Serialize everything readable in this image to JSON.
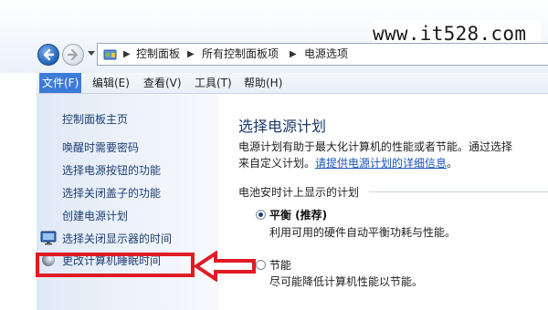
{
  "watermark": "www.it528.com",
  "address_bar": {
    "icon": "control-panel-icon",
    "breadcrumbs": [
      "控制面板",
      "所有控制面板项",
      "电源选项"
    ]
  },
  "menu": {
    "items": [
      "文件(F)",
      "编辑(E)",
      "查看(V)",
      "工具(T)",
      "帮助(H)"
    ],
    "active_item": "文件(F)"
  },
  "left_pane": {
    "title": "控制面板主页",
    "links": [
      {
        "label": "唤醒时需要密码",
        "icon": ""
      },
      {
        "label": "选择电源按钮的功能",
        "icon": ""
      },
      {
        "label": "选择关闭盖子的功能",
        "icon": ""
      },
      {
        "label": "创建电源计划",
        "icon": ""
      },
      {
        "label": "选择关闭显示器的时间",
        "icon": "monitor-icon"
      },
      {
        "label": "更改计算机睡眠时间",
        "icon": "sleep-moon-icon"
      }
    ]
  },
  "annotation": {
    "highlight_color": "#e01b24",
    "arrow_icon": "red-arrow-left-icon"
  },
  "main": {
    "title": "选择电源计划",
    "desc_line1": "电源计划有助于最大化计算机的性能或者节能。通过选择",
    "desc_line2_prefix": "来自定义计划。",
    "desc_link": "请提供电源计划的详细信息",
    "desc_line2_suffix": "。",
    "group_label": "电池安时计上显示的计划",
    "plans": [
      {
        "name": "平衡 (推荐)",
        "description": "利用可用的硬件自动平衡功耗与性能。",
        "selected": true
      },
      {
        "name": "节能",
        "description": "尽可能降低计算机性能以节能。",
        "selected": false
      }
    ]
  }
}
